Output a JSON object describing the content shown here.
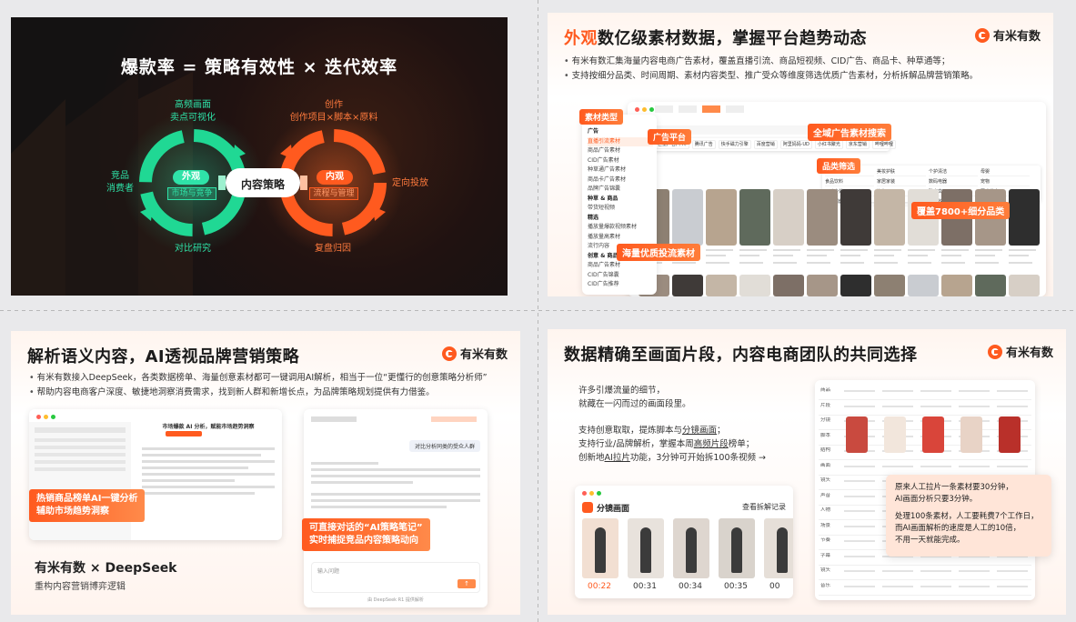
{
  "slide1": {
    "title": "爆款率 = 策略有效性 × 迭代效率",
    "center": "内容策略",
    "left_pill": "外观",
    "left_sub": "市场与竞争",
    "right_pill": "内观",
    "right_sub": "流程与管理",
    "left_top": [
      "高频画面",
      "卖点可视化"
    ],
    "left_side": [
      "竞品",
      "消费者"
    ],
    "left_bottom": "对比研究",
    "right_top": [
      "创作",
      "创作项目×脚本×原料"
    ],
    "right_side": "定向投放",
    "right_bottom": "复盘归因",
    "colors": {
      "green": "#2fe3a8",
      "orange": "#ff7a3d"
    }
  },
  "slide2": {
    "title_hl": "外观",
    "title_rest": "数亿级素材数据，掌握平台趋势动态",
    "logo": "有米有数",
    "bullets": [
      "有米有数汇集海量内容电商广告素材，覆盖直播引流、商品短视频、CID广告、商品卡、种草通等；",
      "支持按细分品类、时间周期、素材内容类型、推广受众等维度筛选优质广告素材，分析拆解品牌营销策略。"
    ],
    "tags": {
      "material_type": "素材类型",
      "ad_platform": "广告平台",
      "all_network": "全域广告素材搜索",
      "category_filter": "品类筛选",
      "massive": "海量优质投流素材",
      "coverage": "覆盖7800+细分品类"
    },
    "menu": [
      "广告",
      "直播引流素材",
      "商品广告素材",
      "CID广告素材",
      "种草通广告素材",
      "商品卡广告素材",
      "品牌广告锦囊",
      "种草 & 商品",
      "带货短视频",
      "精选",
      "播放量爆款视频素材",
      "播放量高素材",
      "流行内容",
      "创意 & 商品",
      "商品广告素材",
      "CID广告锦囊",
      "CID广告推荐"
    ],
    "platform_chips": [
      "巨量广告/千川",
      "腾讯广告",
      "快手磁力引擎",
      "百度营销",
      "阿里妈妈·UD",
      "小红书聚光",
      "京东营销",
      "哔哩哔哩"
    ],
    "category_chips": [
      "服饰鞋包",
      "美妆护肤",
      "个护清洁",
      "母婴",
      "食品饮料",
      "家居家装",
      "数码电器",
      "宠物",
      "运动户外",
      "汽车",
      "珠宝文玩",
      "图书教育",
      "医疗保健",
      "本地生活",
      "艺术收藏",
      "虚拟"
    ]
  },
  "slide3": {
    "title": "解析语义内容，AI透视品牌营销策略",
    "logo": "有米有数",
    "bullets": [
      "有米有数接入DeepSeek，各类数据榜单、海量创意素材都可一键调用AI解析，相当于一位“更懂行的创意策略分析师”",
      "帮助内容电商客户深度、敏捷地洞察消费需求，找到新人群和新增长点，为品牌策略规划提供有力借鉴。"
    ],
    "banner_left": [
      "热销商品榜单AI一键分析",
      "辅助市场趋势洞察"
    ],
    "banner_right": [
      "可直接对话的“AI策略笔记”",
      "实时捕捉竞品内容策略动向"
    ],
    "brand_line": "有米有数 × DeepSeek",
    "brand_sub": "重构内容营销博弈逻辑",
    "chat_user": "对比分析同类的受众人群",
    "chat_input": "输入问题",
    "chat_footer": "由 DeepSeek R1 提供解析",
    "app_title": "市场爆款 AI 分析，赋能市场趋势洞察"
  },
  "slide4": {
    "title": "数据精确至画面片段，内容电商团队的共同选择",
    "logo": "有米有数",
    "para1": [
      "许多引爆流量的细节，",
      "就藏在一闪而过的画面段里。"
    ],
    "para2_a": "你可以创意取取，提炼脚本与",
    "lines": [
      [
        "支持创意取取，提炼脚本与",
        "分镜画面",
        "；"
      ],
      [
        "支持行业/品牌解析，掌握本周",
        "高频片段",
        "榜单；"
      ],
      [
        "创新地",
        "AI拉片",
        "功能，3分钟可开始拆100条视频 →"
      ]
    ],
    "panel_title": "分镜画面",
    "panel_link": "查看拆解记录",
    "times": [
      "00:22",
      "00:31",
      "00:34",
      "00:35",
      "00"
    ],
    "note1": [
      "原来人工拉片一条素材要30分钟，",
      "AI画面分析只要3分钟。"
    ],
    "note2": [
      "处理100条素材，人工要耗费7个工作日，",
      "而AI画面解析的速度是人工的10倍，",
      "不用一天就能完成。"
    ],
    "row_labels": [
      "商品",
      "片段",
      "分镜",
      "脚本",
      "结构",
      "画面",
      "镜头",
      "声音",
      "人物",
      "场景",
      "节奏",
      "字幕",
      "镜头",
      "音乐"
    ]
  }
}
